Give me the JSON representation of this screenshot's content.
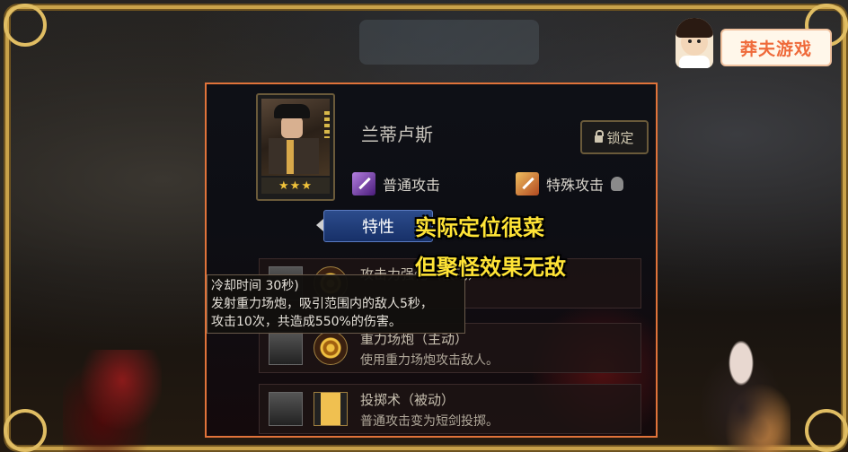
{
  "logo": {
    "text": "莽夫游戏"
  },
  "hero": {
    "name": "兰蒂卢斯",
    "stars": "★★★"
  },
  "lock_button": {
    "label": "锁定"
  },
  "attacks": {
    "normal": "普通攻击",
    "special": "特殊攻击"
  },
  "tabs": {
    "trait": "特性"
  },
  "captions": {
    "line1": "实际定位很菜",
    "line2": "但聚怪效果无敌"
  },
  "tooltip": {
    "line1": "冷却时间 30秒)",
    "line2": "发射重力场炮，吸引范围内的敌人5秒，",
    "line3": "攻击10次，共造成550%的伤害。"
  },
  "skills": [
    {
      "title": "攻击力强化（被动）",
      "desc": ""
    },
    {
      "title": "重力场炮（主动）",
      "desc": "使用重力场炮攻击敌人。"
    },
    {
      "title": "投掷术（被动）",
      "desc": "普通攻击变为短剑投掷。"
    }
  ],
  "colors": {
    "panel_border": "#e0733a",
    "caption": "#ffe436",
    "gold_frame": "#c9a24a"
  }
}
